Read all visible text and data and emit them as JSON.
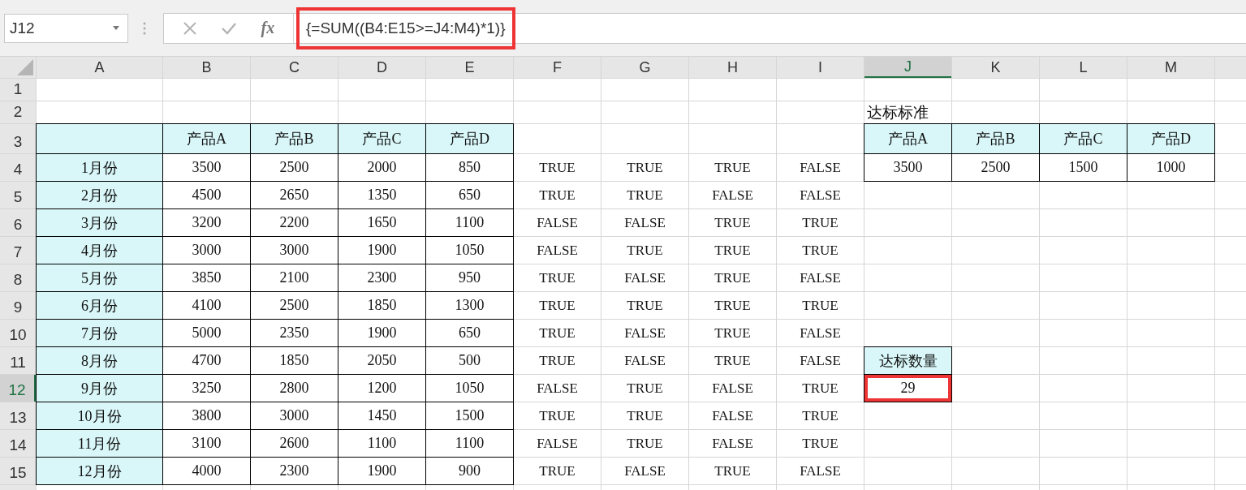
{
  "name_box": {
    "value": "J12"
  },
  "formula_bar": {
    "function_label": "fx",
    "formula": "{=SUM((B4:E15>=J4:M4)*1)}",
    "highlighted": true
  },
  "column_headers": [
    {
      "label": "A",
      "selected": false
    },
    {
      "label": "B",
      "selected": false
    },
    {
      "label": "C",
      "selected": false
    },
    {
      "label": "D",
      "selected": false
    },
    {
      "label": "E",
      "selected": false
    },
    {
      "label": "F",
      "selected": false
    },
    {
      "label": "G",
      "selected": false
    },
    {
      "label": "H",
      "selected": false
    },
    {
      "label": "I",
      "selected": false
    },
    {
      "label": "J",
      "selected": true
    },
    {
      "label": "K",
      "selected": false
    },
    {
      "label": "L",
      "selected": false
    },
    {
      "label": "M",
      "selected": false
    }
  ],
  "row_headers": [
    {
      "label": "1",
      "selected": false
    },
    {
      "label": "2",
      "selected": false
    },
    {
      "label": "3",
      "selected": false
    },
    {
      "label": "4",
      "selected": false
    },
    {
      "label": "5",
      "selected": false
    },
    {
      "label": "6",
      "selected": false
    },
    {
      "label": "7",
      "selected": false
    },
    {
      "label": "8",
      "selected": false
    },
    {
      "label": "9",
      "selected": false
    },
    {
      "label": "10",
      "selected": false
    },
    {
      "label": "11",
      "selected": false
    },
    {
      "label": "12",
      "selected": true
    },
    {
      "label": "13",
      "selected": false
    },
    {
      "label": "14",
      "selected": false
    },
    {
      "label": "15",
      "selected": false
    }
  ],
  "sales_table": {
    "headers": [
      "产品A",
      "产品B",
      "产品C",
      "产品D"
    ],
    "rows": [
      {
        "month": "1月份",
        "values": [
          "3500",
          "2500",
          "2000",
          "850"
        ]
      },
      {
        "month": "2月份",
        "values": [
          "4500",
          "2650",
          "1350",
          "650"
        ]
      },
      {
        "month": "3月份",
        "values": [
          "3200",
          "2200",
          "1650",
          "1100"
        ]
      },
      {
        "month": "4月份",
        "values": [
          "3000",
          "3000",
          "1900",
          "1050"
        ]
      },
      {
        "month": "5月份",
        "values": [
          "3850",
          "2100",
          "2300",
          "950"
        ]
      },
      {
        "month": "6月份",
        "values": [
          "4100",
          "2500",
          "1850",
          "1300"
        ]
      },
      {
        "month": "7月份",
        "values": [
          "5000",
          "2350",
          "1900",
          "650"
        ]
      },
      {
        "month": "8月份",
        "values": [
          "4700",
          "1850",
          "2050",
          "500"
        ]
      },
      {
        "month": "9月份",
        "values": [
          "3250",
          "2800",
          "1200",
          "1050"
        ]
      },
      {
        "month": "10月份",
        "values": [
          "3800",
          "3000",
          "1450",
          "1500"
        ]
      },
      {
        "month": "11月份",
        "values": [
          "3100",
          "2600",
          "1100",
          "1100"
        ]
      },
      {
        "month": "12月份",
        "values": [
          "4000",
          "2300",
          "1900",
          "900"
        ]
      }
    ]
  },
  "comparison": [
    [
      "TRUE",
      "TRUE",
      "TRUE",
      "FALSE"
    ],
    [
      "TRUE",
      "TRUE",
      "FALSE",
      "FALSE"
    ],
    [
      "FALSE",
      "FALSE",
      "TRUE",
      "TRUE"
    ],
    [
      "FALSE",
      "TRUE",
      "TRUE",
      "TRUE"
    ],
    [
      "TRUE",
      "FALSE",
      "TRUE",
      "FALSE"
    ],
    [
      "TRUE",
      "TRUE",
      "TRUE",
      "TRUE"
    ],
    [
      "TRUE",
      "FALSE",
      "TRUE",
      "FALSE"
    ],
    [
      "TRUE",
      "FALSE",
      "TRUE",
      "FALSE"
    ],
    [
      "FALSE",
      "TRUE",
      "FALSE",
      "TRUE"
    ],
    [
      "TRUE",
      "TRUE",
      "FALSE",
      "TRUE"
    ],
    [
      "FALSE",
      "TRUE",
      "FALSE",
      "TRUE"
    ],
    [
      "TRUE",
      "FALSE",
      "TRUE",
      "FALSE"
    ]
  ],
  "standard": {
    "title": "达标标准",
    "headers": [
      "产品A",
      "产品B",
      "产品C",
      "产品D"
    ],
    "values": [
      "3500",
      "2500",
      "1500",
      "1000"
    ]
  },
  "count": {
    "label": "达标数量",
    "value": "29",
    "highlighted": true
  }
}
